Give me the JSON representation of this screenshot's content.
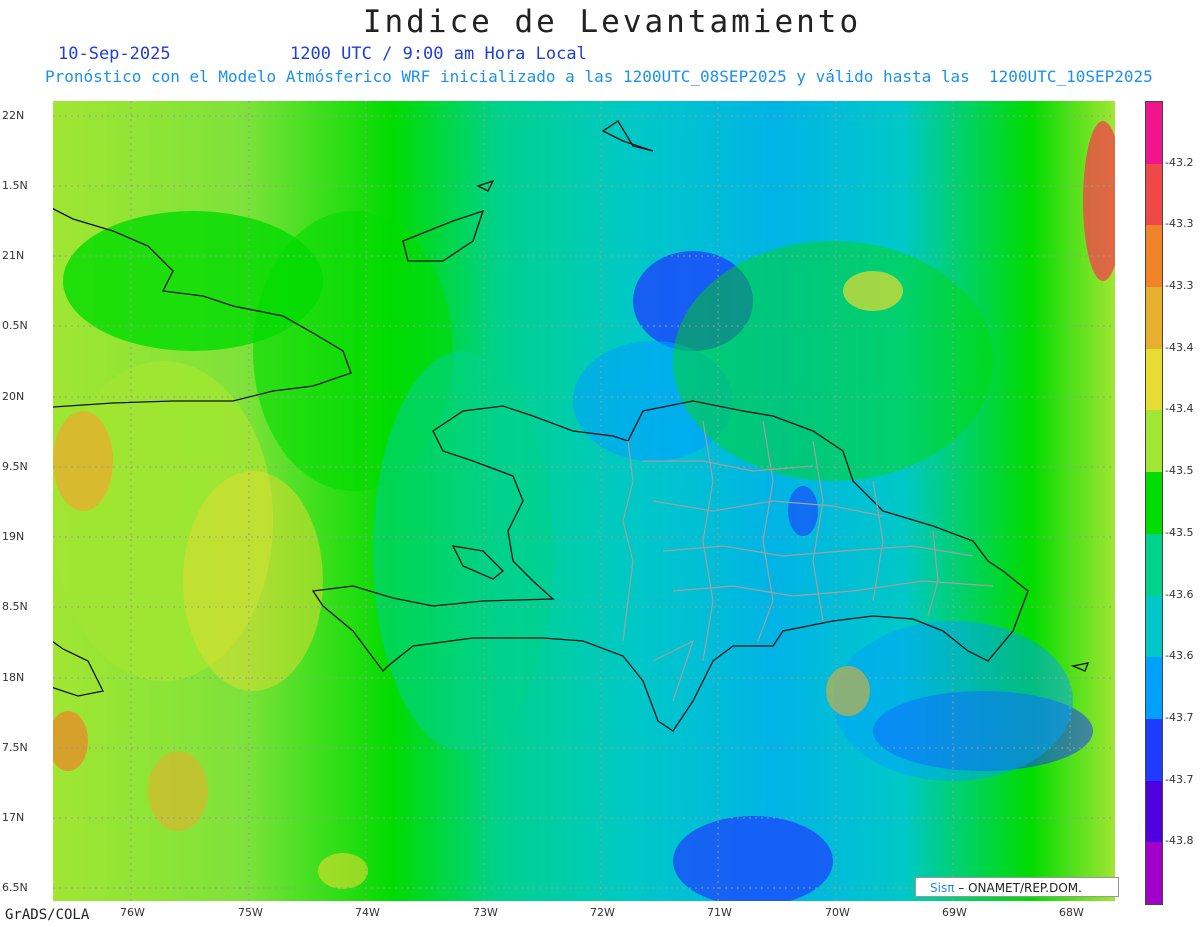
{
  "title": "Indice de Levantamiento",
  "date_label": "10-Sep-2025",
  "time_label": "1200 UTC / 9:00 am Hora Local",
  "forecast_line": "Pronóstico con el Modelo Atmósferico WRF inicializado a las 1200UTC_08SEP2025 y válido hasta las  1200UTC_10SEP2025",
  "footer_left": "GrADS/COLA",
  "credit": {
    "brand": "Sisπ",
    "text": " – ONAMET/REP.DOM."
  },
  "lat_labels": [
    "22N",
    "1.5N",
    "21N",
    "0.5N",
    "20N",
    "9.5N",
    "19N",
    "8.5N",
    "18N",
    "7.5N",
    "17N",
    "6.5N"
  ],
  "lon_labels": [
    "76W",
    "75W",
    "74W",
    "73W",
    "72W",
    "71W",
    "70W",
    "69W",
    "68W"
  ],
  "colorbar": {
    "labels": [
      "-43.2",
      "-43.3",
      "-43.3",
      "-43.4",
      "-43.4",
      "-43.5",
      "-43.5",
      "-43.6",
      "-43.6",
      "-43.7",
      "-43.7",
      "-43.8"
    ],
    "colors": [
      "#f0158c",
      "#f04848",
      "#f08228",
      "#e6af2d",
      "#e6dc32",
      "#a0e632",
      "#00dc00",
      "#00d28c",
      "#00c8c8",
      "#00a0ff",
      "#1e3cff",
      "#5000dc",
      "#a000c8"
    ]
  }
}
